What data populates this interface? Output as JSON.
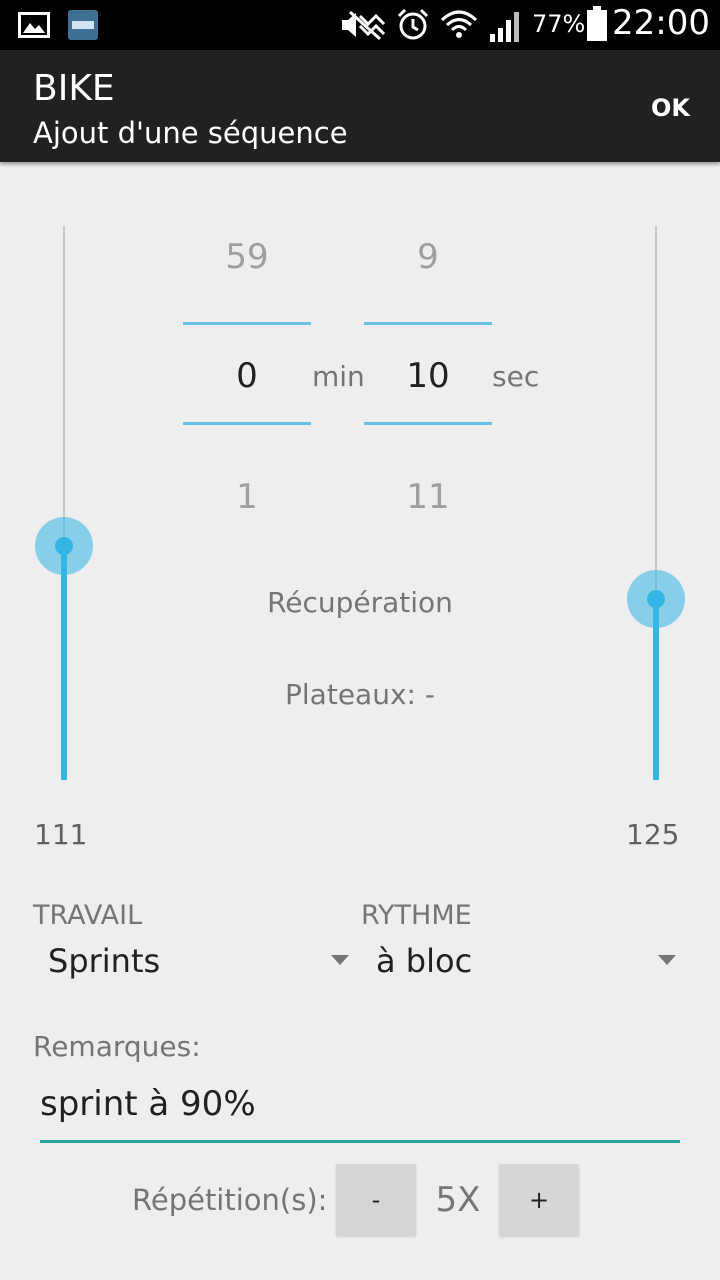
{
  "status_bar": {
    "icons": [
      "gallery-icon",
      "app-icon",
      "mute-icon",
      "alarm-icon",
      "wifi-icon",
      "signal-icon",
      "battery-icon"
    ],
    "battery": "77%",
    "time": "22:00"
  },
  "toolbar": {
    "title": "BIKE",
    "subtitle": "Ajout d'une séquence",
    "ok_label": "OK"
  },
  "left_slider": {
    "value": "111",
    "level": 0.42,
    "accent": "#33b5e5"
  },
  "right_slider": {
    "value": "125",
    "level": 0.33,
    "accent": "#33b5e5"
  },
  "duration": {
    "minutes": {
      "prev": "59",
      "current": "0",
      "next": "1",
      "unit": "min"
    },
    "seconds": {
      "prev": "9",
      "current": "10",
      "next": "11",
      "unit": "sec"
    }
  },
  "phase_label": "Récupération",
  "plateaux_label": "Plateaux: -",
  "travail": {
    "header": "TRAVAIL",
    "value": "Sprints"
  },
  "rythme": {
    "header": "RYTHME",
    "value": "à bloc"
  },
  "remarks": {
    "label": "Remarques:",
    "value": "sprint à 90%",
    "underline_color": "#26a69a"
  },
  "repetitions": {
    "label": "Répétition(s):",
    "minus_label": "-",
    "count": "5X",
    "plus_label": "+"
  }
}
